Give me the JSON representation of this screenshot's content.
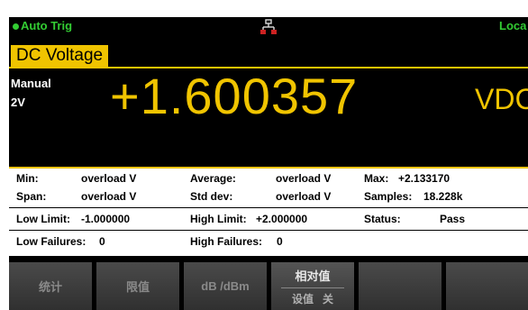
{
  "status_bar": {
    "trigger_mode": "Auto Trig",
    "trigger_color": "#33cc33",
    "network_icon": "lan-network-icon",
    "remote_status": "Loca"
  },
  "measurement": {
    "function": "DC Voltage",
    "range_mode": "Manual",
    "range": "2V",
    "reading": "+1.600357",
    "unit": "VDC",
    "accent_color": "#f0c400"
  },
  "stats": {
    "min_label": "Min:",
    "min_value": "overload V",
    "average_label": "Average:",
    "average_value": "overload V",
    "max_label": "Max:",
    "max_value": "+2.133170",
    "span_label": "Span:",
    "span_value": "overload V",
    "std_dev_label": "Std dev:",
    "std_dev_value": "overload V",
    "samples_label": "Samples:",
    "samples_value": "18.228k"
  },
  "limits": {
    "low_limit_label": "Low Limit:",
    "low_limit_value": "-1.000000",
    "high_limit_label": "High Limit:",
    "high_limit_value": "+2.000000",
    "status_label": "Status:",
    "status_value": "Pass",
    "low_failures_label": "Low Failures:",
    "low_failures_value": "0",
    "high_failures_label": "High Failures:",
    "high_failures_value": "0"
  },
  "softkeys": [
    {
      "label": "统计"
    },
    {
      "label": "限值"
    },
    {
      "label": "dB /dBm"
    },
    {
      "label": "相对值",
      "sub_label": "设值",
      "sub_state": "关"
    },
    {
      "label": ""
    },
    {
      "label": ""
    }
  ]
}
